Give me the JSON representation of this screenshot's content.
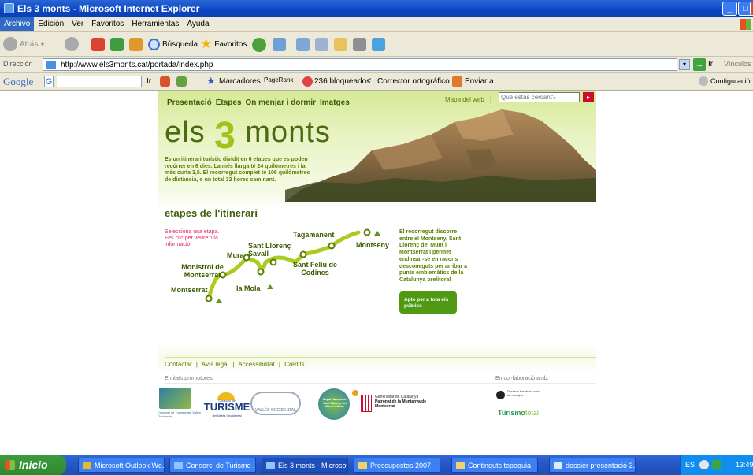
{
  "window": {
    "title": "Els 3 monts - Microsoft Internet Explorer"
  },
  "menu": [
    "Archivo",
    "Edición",
    "Ver",
    "Favoritos",
    "Herramientas",
    "Ayuda"
  ],
  "toolbar": {
    "back": "Atrás",
    "search": "Búsqueda",
    "favorites": "Favoritos"
  },
  "address": {
    "label": "Dirección",
    "url": "http://www.els3monts.cat/portada/index.php",
    "go": "Ir",
    "links": "Vínculos"
  },
  "googlebar": {
    "brand": "Google",
    "go": "Ir",
    "bookmarks": "Marcadores",
    "pagerank": "PageRank",
    "blocked": "236 bloqueados",
    "spellcheck": "Corrector ortográfico",
    "send": "Enviar a",
    "settings": "Configuración"
  },
  "site": {
    "nav": [
      "Presentació",
      "Etapes",
      "On menjar i dormir",
      "Imatges"
    ],
    "sitemap": "Mapa del web",
    "separator": "|",
    "search_placeholder": "Què estàs cercant?",
    "logo_pre": "els",
    "logo_num": "3",
    "logo_post": "monts",
    "intro": "Es un itinerari turístic dividit en 6 etapes que es poden recórrer en 6 dies. La més llarga té 24 quilòmetres i la més curta 3,5. El recorregut complet té 106 quilòmetres de distància, o un total 32 hores caminant.",
    "section_title": "etapes de l'itinerari",
    "select_hint": "Selecciona una etapa. Fes clic per veure'n la informació",
    "stages": [
      "Montserrat",
      "Monistrol de Montserrat",
      "Mura",
      "la Mola",
      "Sant Llorenç Savall",
      "Sant Feliu de Codines",
      "Tagamanent",
      "Montseny"
    ],
    "description": "El recorregut discorre entre el Montseny, Sant Llorenç del Munt i Montserrat i permet endinsar-se en racons desconeguts per arribar a punts emblemàtics de la Catalunya prelitoral",
    "badge": "Apte per a tota els públics",
    "footer_links": [
      "Contactar",
      "Avís legal",
      "Accessibilitat",
      "Crèdits"
    ],
    "promoters_label": "Entitats promotores",
    "collab_label": "En col·laboració amb:",
    "sponsors": {
      "consorci": "Consorci de Turisme del Vallès Occidental",
      "turisme_small": "Consorci de",
      "turisme": "TURISME",
      "turisme_sub": "del Vallès Occidental",
      "valles": "VALLÈS OCCIDENTAL",
      "espai": "Espai Natural de Sant Llorenç del Munt i l'Obac",
      "generalitat": "Generalitat de Catalunya",
      "patronat": "Patronat de la Muntanya de Montserrat",
      "diputacio": "Diputació Barcelona xarxa de municipis",
      "turismo_a": "Turismo",
      "turismo_b": "total"
    }
  },
  "taskbar": {
    "start": "Inicio",
    "tasks": [
      "Microsoft Outlook We...",
      "Consorci de Turisme ...",
      "Els 3 monts - Microsof...",
      "Pressupostos 2007",
      "Continguts topoguia",
      "dossier presentació 3..."
    ],
    "lang": "ES",
    "time": "13:49"
  }
}
